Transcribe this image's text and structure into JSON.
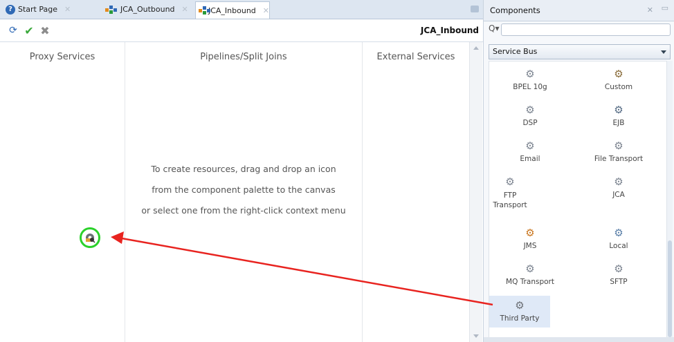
{
  "tabs": [
    {
      "label": "Start Page",
      "icon": "help-icon"
    },
    {
      "label": "JCA_Outbound",
      "icon": "jca-icon"
    },
    {
      "label": "JCA_Inbound",
      "icon": "jca-icon",
      "active": true
    }
  ],
  "toolbar": {
    "icons": [
      "validate-icon",
      "check-icon",
      "delete-icon"
    ],
    "title": "JCA_Inbound"
  },
  "canvas": {
    "columns": [
      "Proxy Services",
      "Pipelines/Split Joins",
      "External Services"
    ],
    "hint": [
      "To create resources, drag and drop an icon",
      "from the component palette to the canvas",
      "or select one from the right-click context menu"
    ]
  },
  "palette": {
    "title": "Components",
    "search_placeholder": "",
    "category": "Service Bus",
    "items": [
      {
        "label": "BPEL 10g",
        "icon": "gear-icon"
      },
      {
        "label": "Custom",
        "icon": "custom-gear-icon"
      },
      {
        "label": "DSP",
        "icon": "gear-icon"
      },
      {
        "label": "EJB",
        "icon": "ejb-gear-icon"
      },
      {
        "label": "Email",
        "icon": "gear-icon"
      },
      {
        "label": "File Transport",
        "icon": "gear-icon"
      },
      {
        "label": "FTP Transport",
        "icon": "gear-icon"
      },
      {
        "label": "JCA",
        "icon": "gear-icon"
      },
      {
        "label": "JMS",
        "icon": "jms-gear-icon"
      },
      {
        "label": "Local",
        "icon": "local-gear-icon"
      },
      {
        "label": "MQ Transport",
        "icon": "gear-icon"
      },
      {
        "label": "SFTP",
        "icon": "gear-icon"
      },
      {
        "label": "Third Party",
        "icon": "third-party-gear-icon",
        "selected": true
      }
    ]
  },
  "colors": {
    "arrow": "#e8231f",
    "highlight_ring": "#2ad12a",
    "selected_item_bg": "#dfe9f7",
    "tab_bar": "#dde6f1"
  }
}
